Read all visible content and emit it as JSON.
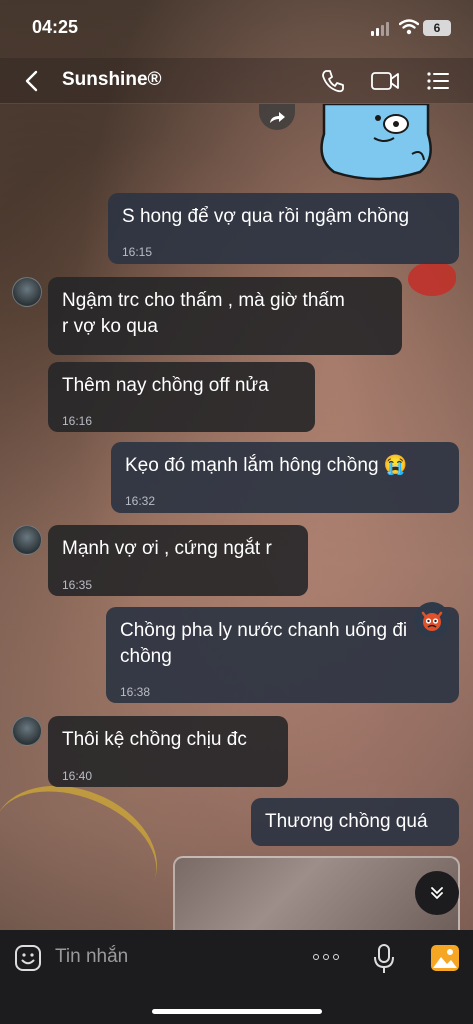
{
  "status": {
    "time": "04:25",
    "battery": "6"
  },
  "header": {
    "title": "Sunshine®"
  },
  "messages": [
    {
      "side": "out",
      "text": "S hong để vợ qua rồi ngậm chồng",
      "time": "16:15"
    },
    {
      "side": "in",
      "line1": "Ngậm trc cho thấm , mà giờ thấm",
      "line2": "r vợ ko qua"
    },
    {
      "side": "in",
      "text": "Thêm nay chồng off nửa",
      "time": "16:16"
    },
    {
      "side": "out",
      "text": "Kẹo đó mạnh lắm hông chồng 😭",
      "time": "16:32"
    },
    {
      "side": "in",
      "text": "Mạnh vợ ơi , cứng ngắt r",
      "time": "16:35"
    },
    {
      "side": "out",
      "line1": "Chồng pha ly nước chanh uống đi",
      "line2": "chồng",
      "time": "16:38"
    },
    {
      "side": "in",
      "text": "Thôi kệ chồng chịu đc",
      "time": "16:40"
    },
    {
      "side": "out",
      "text": "Thương chồng quá"
    }
  ],
  "input": {
    "placeholder": "Tin nhắn"
  },
  "icons": {
    "back": "chevron-left-icon",
    "call": "phone-icon",
    "video": "video-camera-icon",
    "menu": "list-menu-icon",
    "emoji": "emoji-icon",
    "more": "more-dots-icon",
    "mic": "microphone-icon",
    "image": "image-gallery-icon",
    "scroll": "scroll-down-icon"
  },
  "colors": {
    "bubble_in": "#262628",
    "bubble_out": "#2c3442",
    "input_bar": "#1c1c1e",
    "image_button": "#f5a623"
  }
}
